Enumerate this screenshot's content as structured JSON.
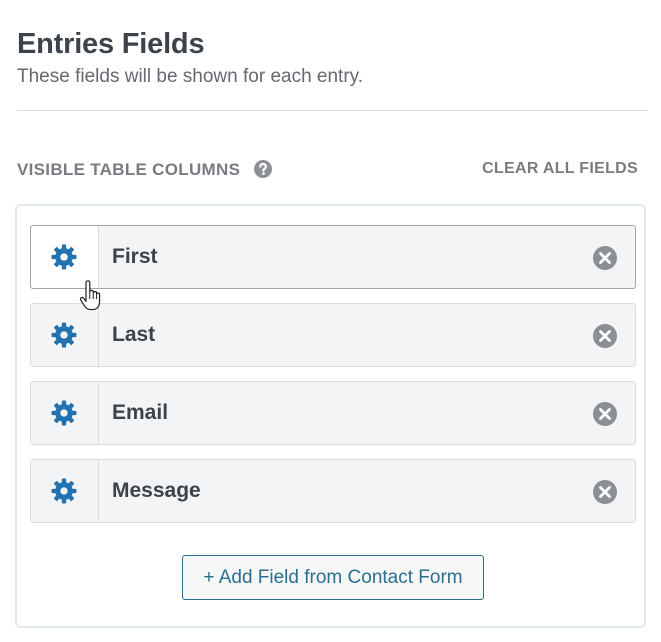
{
  "header": {
    "title": "Entries Fields",
    "subtitle": "These fields will be shown for each entry."
  },
  "columns_section": {
    "label": "VISIBLE TABLE COLUMNS",
    "help_icon": "question-circle-icon",
    "clear_all_label": "CLEAR ALL FIELDS"
  },
  "fields": [
    {
      "label": "First",
      "settings_icon": "gear-icon",
      "remove_icon": "remove-circle-icon",
      "active": true
    },
    {
      "label": "Last",
      "settings_icon": "gear-icon",
      "remove_icon": "remove-circle-icon",
      "active": false
    },
    {
      "label": "Email",
      "settings_icon": "gear-icon",
      "remove_icon": "remove-circle-icon",
      "active": false
    },
    {
      "label": "Message",
      "settings_icon": "gear-icon",
      "remove_icon": "remove-circle-icon",
      "active": false
    }
  ],
  "add_field_button": {
    "label": "+ Add Field from Contact Form"
  },
  "colors": {
    "accent": "#2271b1",
    "button_text": "#2c6e8f",
    "remove_icon": "#8c8f94",
    "heading": "#3c434a",
    "muted": "#787c82"
  },
  "cursor": "hand-pointer-icon"
}
